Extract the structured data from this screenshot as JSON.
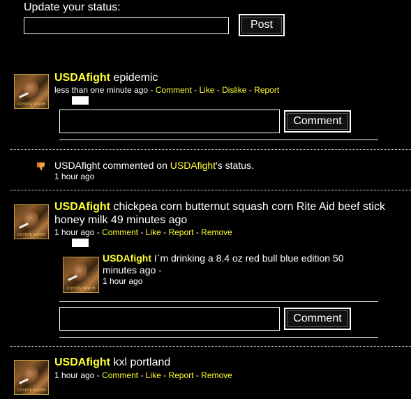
{
  "status": {
    "label": "Update your status:",
    "input_value": "",
    "post_label": "Post"
  },
  "posts": [
    {
      "author": "USDAfight",
      "text": "epidemic",
      "time": "less than one minute ago",
      "actions": [
        "Comment",
        "Like",
        "Dislike",
        "Report"
      ],
      "comment_button": "Comment"
    },
    {
      "author": "USDAfight",
      "activity": "commented on",
      "target": "USDAfight",
      "target_suffix": "'s status.",
      "time": "1 hour ago"
    },
    {
      "author": "USDAfight",
      "text_line1": "chickpea corn butternut squash corn Rite Aid beef stick",
      "text_line2": "honey milk 49 minutes ago",
      "time": "1 hour ago",
      "actions": [
        "Comment",
        "Like",
        "Report",
        "Remove"
      ],
      "reply": {
        "author": "USDAfight",
        "text_line1": "I`m drinking a 8.4 oz red bull blue edition 50",
        "text_line2": "minutes ago -",
        "time": "1 hour ago"
      },
      "comment_button": "Comment"
    },
    {
      "author": "USDAfight",
      "text": "kxl portland",
      "time": "1 hour ago",
      "actions": [
        "Comment",
        "Like",
        "Report",
        "Remove"
      ]
    }
  ],
  "avatar_caption": "COYOTE NORTH",
  "separator": " - ",
  "colors": {
    "link": "#ffff33",
    "background": "#000000",
    "text": "#ffffff"
  }
}
